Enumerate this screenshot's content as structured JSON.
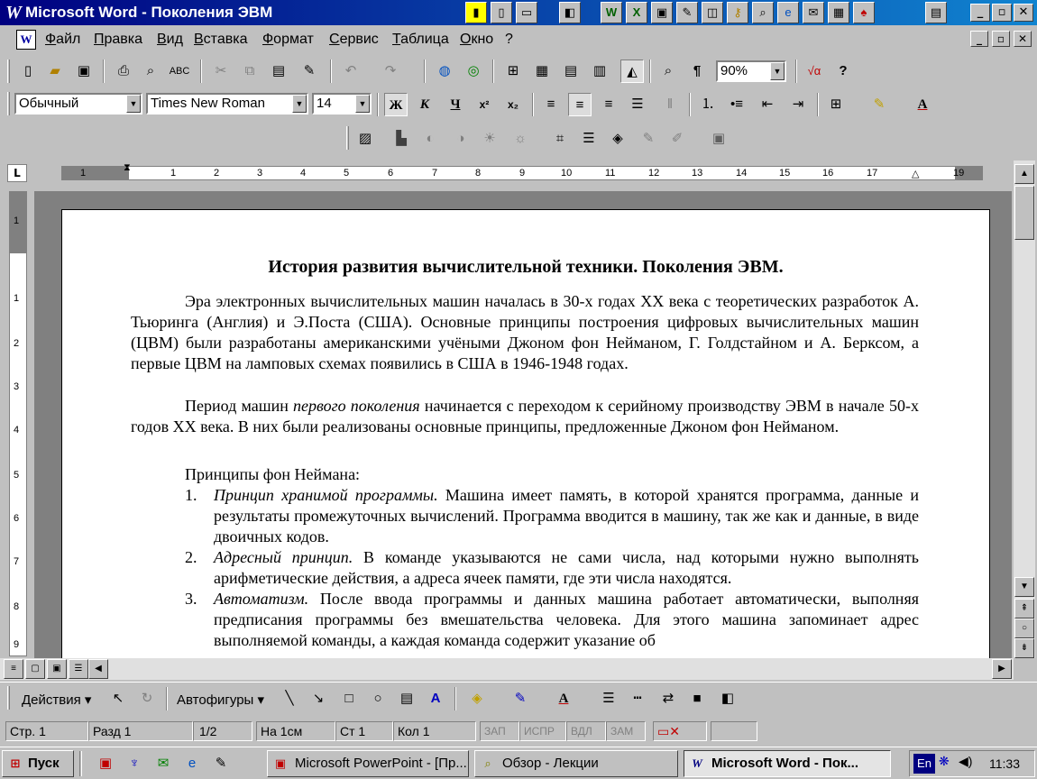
{
  "window": {
    "title": "Microsoft Word - Поколения ЭВМ"
  },
  "menu": {
    "items": [
      "Файл",
      "Правка",
      "Вид",
      "Вставка",
      "Формат",
      "Сервис",
      "Таблица",
      "Окно",
      "?"
    ]
  },
  "toolbar": {
    "zoom": "90%"
  },
  "formatting": {
    "style": "Обычный",
    "font": "Times New Roman",
    "size": "14"
  },
  "ruler": {
    "numbers": [
      "1",
      "1",
      "2",
      "3",
      "4",
      "5",
      "6",
      "7",
      "8",
      "9",
      "10",
      "11",
      "12",
      "13",
      "14",
      "15",
      "16",
      "17",
      "19"
    ]
  },
  "vruler": {
    "numbers": [
      "1",
      "1",
      "2",
      "3",
      "4",
      "5",
      "6",
      "7",
      "8",
      "9"
    ]
  },
  "document": {
    "title": "История развития вычислительной техники. Поколения ЭВМ.",
    "p1": "Эра электронных вычислительных машин началась в 30-х годах XX века с теоретических разработок А. Тьюринга (Англия) и Э.Поста (США). Основные принципы построения цифровых вычислительных машин (ЦВМ) были разработаны американскими учёными Джоном фон Нейманом, Г. Голдстайном и А. Берксом, а первые ЦВМ на ламповых схемах появились в США в 1946-1948 годах.",
    "p2_a": "Период машин ",
    "p2_em": "первого поколения",
    "p2_b": " начинается с переходом к серийному производству ЭВМ в начале 50-х годов XX века. В них были реализованы основные принципы, предложенные Джоном фон Нейманом.",
    "p3": "Принципы фон Неймана:",
    "list": [
      {
        "num": "1.",
        "em": "Принцип хранимой программы.",
        "text": " Машина имеет память, в которой хранятся программа, данные и результаты промежуточных вычислений. Программа вводится в машину, так же как и данные, в виде двоичных кодов."
      },
      {
        "num": "2.",
        "em": "Адресный принцип.",
        "text": " В команде указываются не сами числа, над которыми нужно выполнять арифметические действия, а адреса ячеек памяти, где эти числа находятся."
      },
      {
        "num": "3.",
        "em": "Автоматизм.",
        "text": " После ввода программы и данных машина работает автоматически, выполняя предписания программы без вмешательства человека. Для этого машина запоминает адрес выполняемой команды, а каждая команда содержит указание об"
      }
    ]
  },
  "drawing": {
    "actions": "Действия",
    "autoshapes": "Автофигуры"
  },
  "status": {
    "page": "Стр. 1",
    "section": "Разд 1",
    "pages": "1/2",
    "at": "На 1см",
    "line": "Ст 1",
    "col": "Кол 1",
    "rec": "ЗАП",
    "trk": "ИСПР",
    "ext": "ВДЛ",
    "ovr": "ЗАМ"
  },
  "taskbar": {
    "start": "Пуск",
    "tasks": [
      "Microsoft PowerPoint - [Пр...",
      "Обзор - Лекции",
      "Microsoft Word - Пок..."
    ],
    "lang": "En",
    "clock": "11:33"
  }
}
